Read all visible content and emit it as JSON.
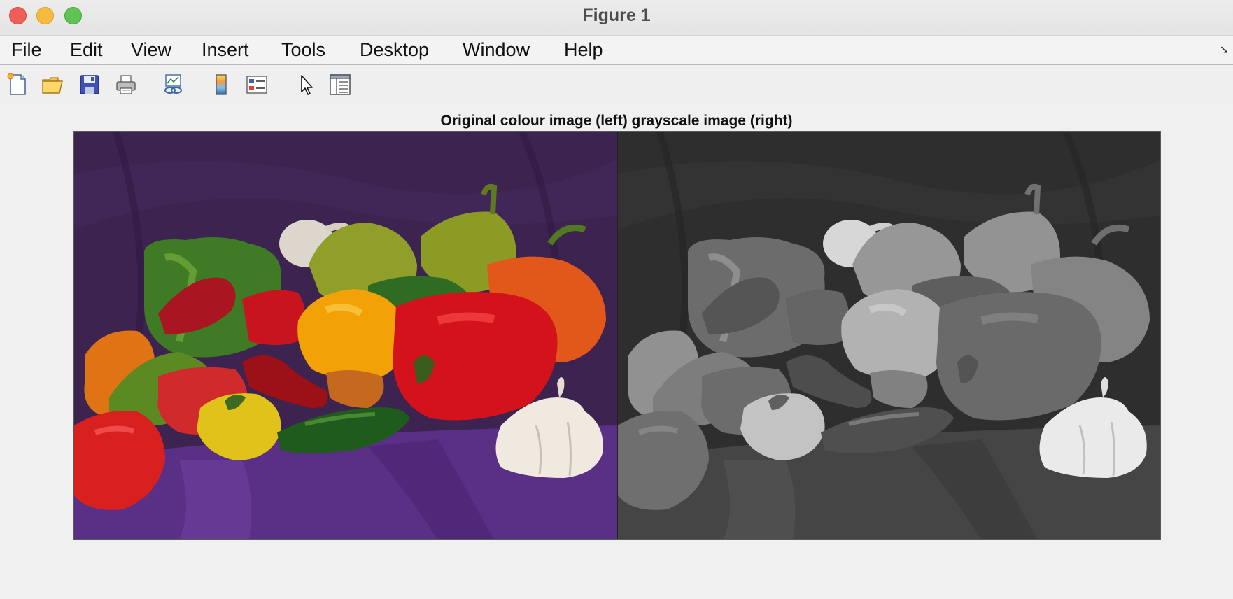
{
  "window": {
    "title": "Figure 1"
  },
  "menubar": {
    "items": [
      "File",
      "Edit",
      "View",
      "Insert",
      "Tools",
      "Desktop",
      "Window",
      "Help"
    ]
  },
  "toolbar": {
    "icons": [
      "new-figure-icon",
      "open-file-icon",
      "save-icon",
      "print-icon",
      "link-plot-icon",
      "insert-colorbar-icon",
      "insert-legend-icon",
      "edit-plot-icon",
      "property-inspector-icon"
    ]
  },
  "figure": {
    "axes_title": "Original colour image (left) grayscale image (right)",
    "panels": [
      "colour-image",
      "grayscale-image"
    ]
  },
  "colors": {
    "close": "#ee5f57",
    "minimize": "#f4bb3f",
    "maximize": "#5fc454",
    "backdrop_purple": "#3c2350",
    "cloth_purple": "#5a2f86"
  }
}
